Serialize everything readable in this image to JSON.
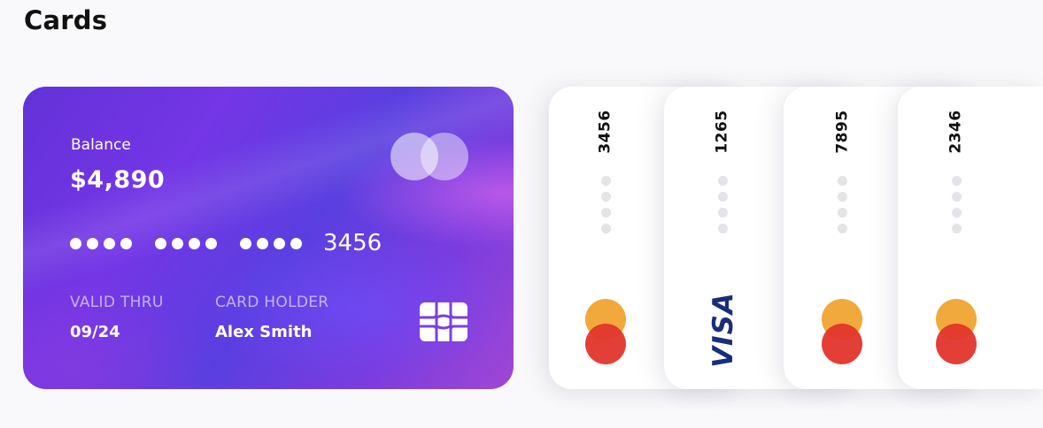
{
  "section": {
    "title": "Cards"
  },
  "main_card": {
    "balance_label": "Balance",
    "balance": "$4,890",
    "last4": "3456",
    "valid_label": "VALID THRU",
    "valid": "09/24",
    "holder_label": "CARD HOLDER",
    "holder": "Alex Smith",
    "brand_icon": "mastercard-icon",
    "chip_icon": "chip-icon"
  },
  "mini_cards": [
    {
      "number": "3456",
      "brand": "mastercard"
    },
    {
      "number": "1265",
      "brand": "visa",
      "brand_label": "VISA"
    },
    {
      "number": "7895",
      "brand": "mastercard"
    },
    {
      "number": "2346",
      "brand": "mastercard"
    }
  ],
  "colors": {
    "card_gradient_start": "#6431d8",
    "card_gradient_end": "#a047d4",
    "mastercard_orange": "#f0a93a",
    "mastercard_red": "#e2352b",
    "visa_blue": "#1a2d7a"
  }
}
